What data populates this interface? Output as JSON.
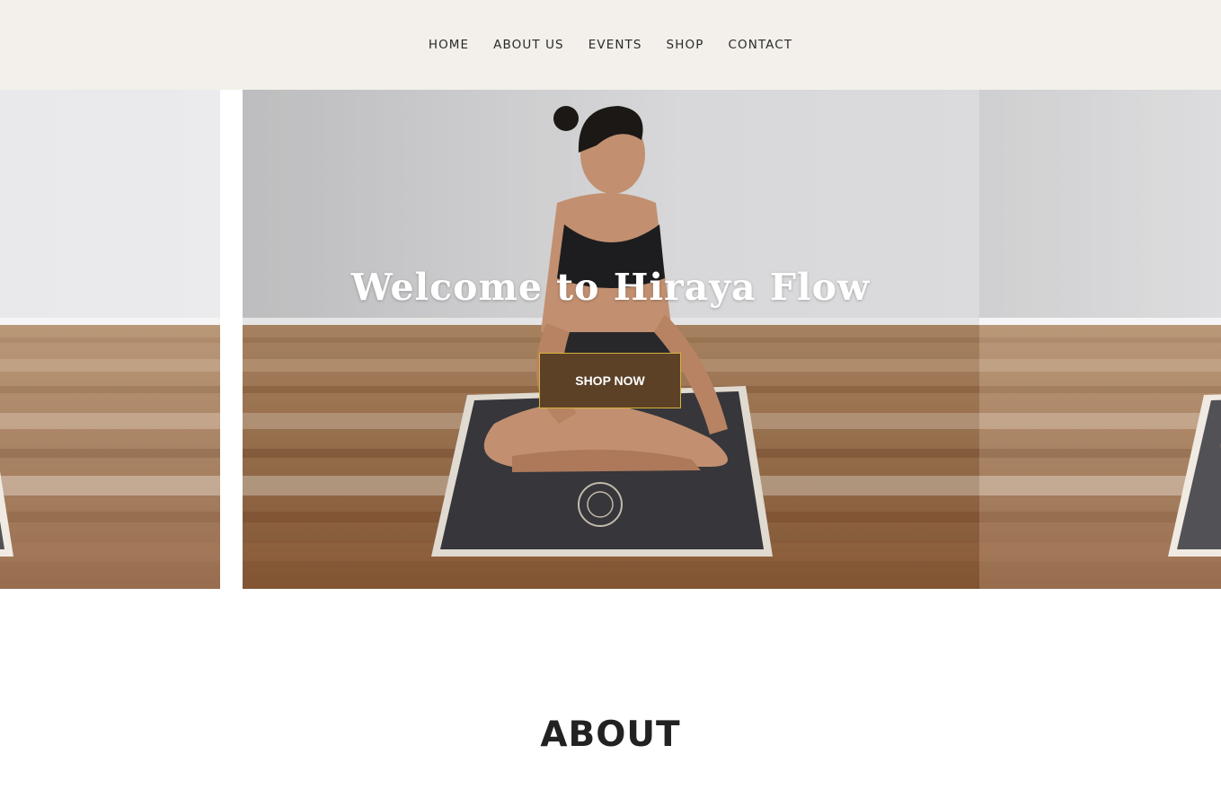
{
  "nav": {
    "items": [
      {
        "label": "HOME"
      },
      {
        "label": "ABOUT US"
      },
      {
        "label": "EVENTS"
      },
      {
        "label": "SHOP"
      },
      {
        "label": "CONTACT"
      }
    ]
  },
  "hero": {
    "title": "Welcome to Hiraya Flow",
    "button_label": "SHOP NOW"
  },
  "about": {
    "title": "ABOUT"
  },
  "colors": {
    "nav_background": "#f3f0eb",
    "button_background": "#5c4127",
    "button_border": "#d6b33c",
    "heading_text": "#222222"
  }
}
